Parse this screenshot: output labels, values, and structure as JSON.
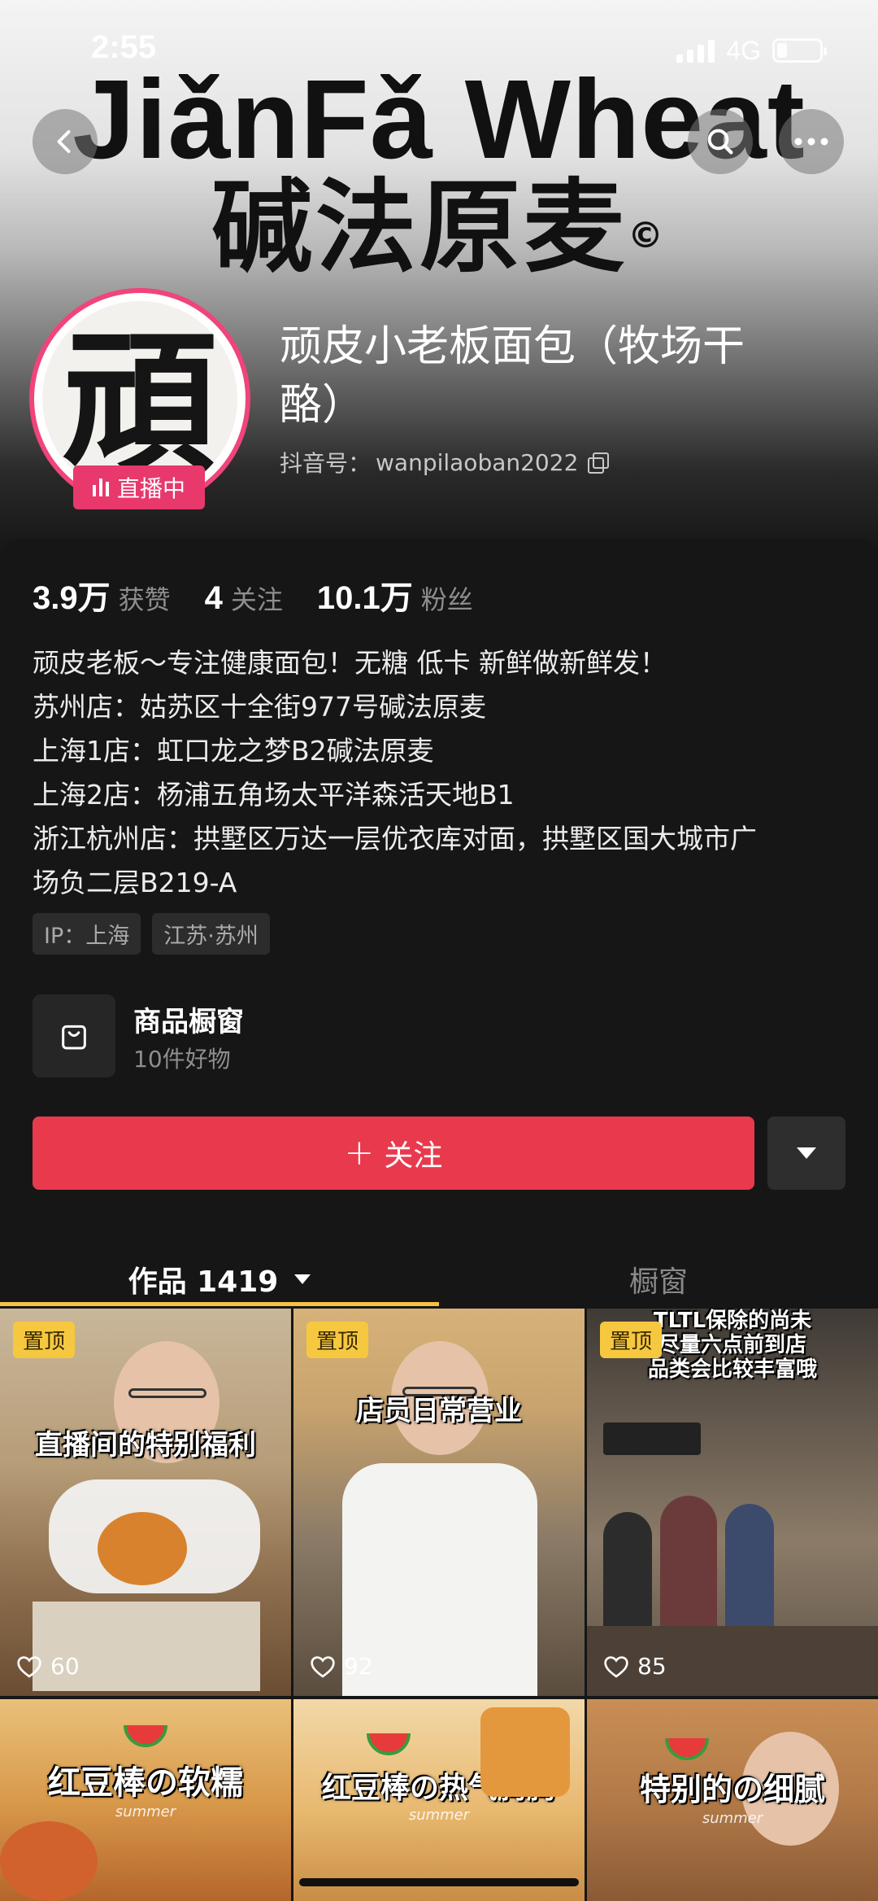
{
  "status_bar": {
    "time": "2:55",
    "network": "4G"
  },
  "cover": {
    "logo_en": "JiǎnFǎ Wheat",
    "logo_cn": "碱法原麦",
    "logo_mark": "©"
  },
  "nav": {
    "back_icon": "chevron-left-icon",
    "search_icon": "search-icon",
    "more_icon": "more-dots-icon"
  },
  "profile": {
    "avatar_char": "頑",
    "live_label": "直播中",
    "nickname": "顽皮小老板面包（牧场干酪）",
    "douyin_id_label": "抖音号：",
    "douyin_id": "wanpilaoban2022"
  },
  "stats": [
    {
      "num": "3.9万",
      "label": "获赞"
    },
    {
      "num": "4",
      "label": "关注"
    },
    {
      "num": "10.1万",
      "label": "粉丝"
    }
  ],
  "bio": [
    "顽皮老板～专注健康面包！无糖 低卡 新鲜做新鲜发！",
    "苏州店：姑苏区十全街977号碱法原麦",
    "上海1店：虹口龙之梦B2碱法原麦",
    "上海2店：杨浦五角场太平洋森活天地B1",
    "浙江杭州店：拱墅区万达一层优衣库对面，拱墅区国大城市广",
    "场负二层B219-A"
  ],
  "tags": [
    "IP：上海",
    "江苏·苏州"
  ],
  "shop": {
    "title": "商品橱窗",
    "subtitle": "10件好物"
  },
  "follow_button": {
    "plus": "+",
    "label": "关注"
  },
  "tabs": {
    "works_label": "作品 1419",
    "showcase_label": "橱窗"
  },
  "videos": [
    {
      "pinned": true,
      "pin_label": "置顶",
      "title": "直播间的特别福利",
      "likes": "60"
    },
    {
      "pinned": true,
      "pin_label": "置顶",
      "title": "店员日常营业",
      "likes": "92"
    },
    {
      "pinned": true,
      "pin_label": "置顶",
      "title": "TLTL保除的尚未\n尽量六点前到店\n品类会比较丰富哦",
      "likes": "85"
    },
    {
      "pinned": false,
      "title": "红豆棒の软糯",
      "subtitle": "summer"
    },
    {
      "pinned": false,
      "title": "红豆棒の热气腾腾",
      "subtitle": "summer"
    },
    {
      "pinned": false,
      "title": "特别的の细腻",
      "subtitle": "summer"
    }
  ],
  "colors": {
    "accent": "#e8394d",
    "live": "#e8386c",
    "pin": "#f6c83f",
    "tab_underline": "#f5c242",
    "background": "#161616"
  }
}
